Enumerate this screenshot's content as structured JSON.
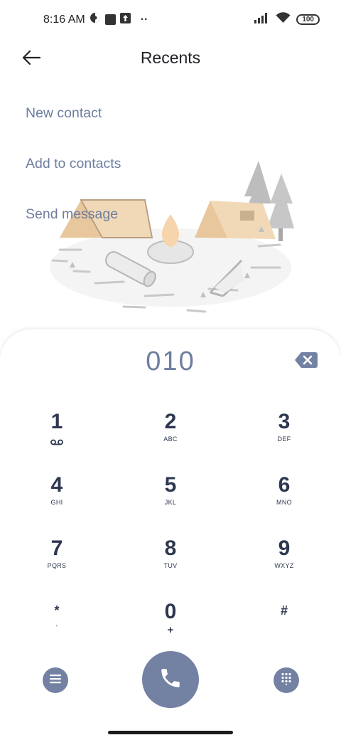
{
  "status_bar": {
    "time": "8:16 AM",
    "dots": "··",
    "battery": "100"
  },
  "header": {
    "title": "Recents"
  },
  "actions": {
    "new_contact": "New contact",
    "add_to_contacts": "Add to contacts",
    "send_message": "Send message"
  },
  "dialer": {
    "number": "010",
    "keys": [
      {
        "digit": "1",
        "letters": ""
      },
      {
        "digit": "2",
        "letters": "ABC"
      },
      {
        "digit": "3",
        "letters": "DEF"
      },
      {
        "digit": "4",
        "letters": "GHI"
      },
      {
        "digit": "5",
        "letters": "JKL"
      },
      {
        "digit": "6",
        "letters": "MNO"
      },
      {
        "digit": "7",
        "letters": "PQRS"
      },
      {
        "digit": "8",
        "letters": "TUV"
      },
      {
        "digit": "9",
        "letters": "WXYZ"
      },
      {
        "digit": "*",
        "letters": ","
      },
      {
        "digit": "0",
        "letters": "+"
      },
      {
        "digit": "#",
        "letters": ""
      }
    ]
  },
  "icons": {
    "voicemail": "voicemail-icon",
    "backspace": "backspace-icon",
    "menu": "menu-icon",
    "call": "phone-icon",
    "keypad": "dialpad-icon",
    "back": "back-arrow-icon"
  },
  "colors": {
    "accent": "#6e7ea0",
    "button": "#7381a3",
    "digit": "#2e3750"
  }
}
